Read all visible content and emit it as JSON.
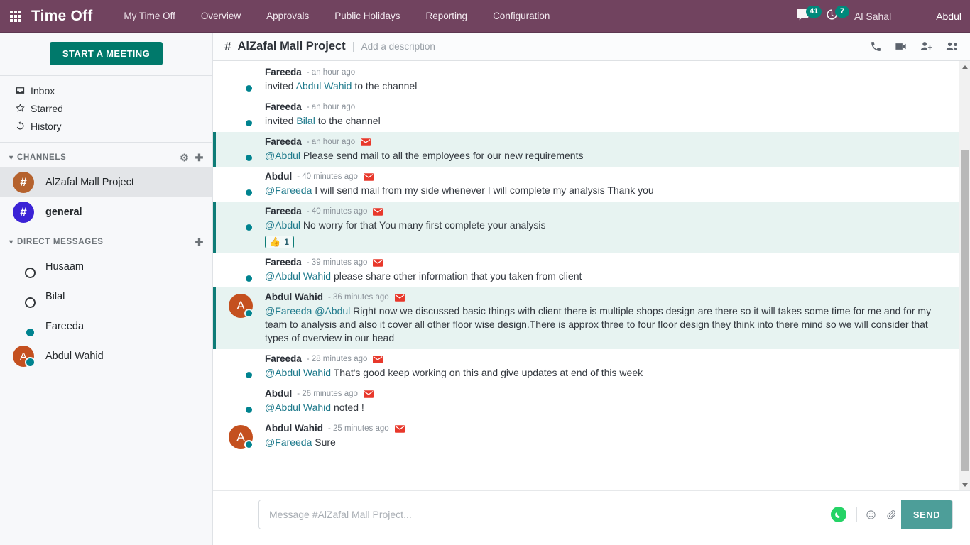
{
  "navbar": {
    "brand": "Time Off",
    "apps_icon": "apps-grid-icon",
    "menu": [
      {
        "label": "My Time Off"
      },
      {
        "label": "Overview"
      },
      {
        "label": "Approvals"
      },
      {
        "label": "Public Holidays"
      },
      {
        "label": "Reporting"
      },
      {
        "label": "Configuration"
      }
    ],
    "messages_icon": "chat-bubble-icon",
    "messages_count": "41",
    "activity_icon": "clock-icon",
    "activity_count": "7",
    "company": "Al Sahal",
    "user": "Abdul",
    "user_avatar": "abdul-avatar",
    "bg_color": "#71435f",
    "badge_color": "#00897b"
  },
  "sidebar": {
    "start_meeting": "START A MEETING",
    "nav": [
      {
        "label": "Inbox",
        "icon": "inbox-icon"
      },
      {
        "label": "Starred",
        "icon": "star-icon"
      },
      {
        "label": "History",
        "icon": "history-icon"
      }
    ],
    "channels": {
      "title": "CHANNELS",
      "settings_icon": "gear-icon",
      "add_icon": "plus-icon",
      "items": [
        {
          "label": "AlZafal Mall Project",
          "hash": "#",
          "color": "#b5622e",
          "active": true,
          "bold": false
        },
        {
          "label": "general",
          "hash": "#",
          "color": "#3b23d6",
          "active": false,
          "bold": true
        }
      ]
    },
    "direct_messages": {
      "title": "DIRECT MESSAGES",
      "add_icon": "plus-icon",
      "items": [
        {
          "label": "Husaam",
          "status": "offline",
          "avatar": "husaam-avatar"
        },
        {
          "label": "Bilal",
          "status": "offline",
          "avatar": "bilal-avatar"
        },
        {
          "label": "Fareeda",
          "status": "online",
          "avatar": "fareeda-avatar"
        },
        {
          "label": "Abdul Wahid",
          "status": "online",
          "avatar": "letter",
          "letter": "A",
          "color": "#c4501f"
        }
      ]
    }
  },
  "channel_header": {
    "hash": "#",
    "title": "AlZafal Mall Project",
    "divider": "|",
    "description_placeholder": "Add a description",
    "icons": [
      {
        "name": "phone-call-icon"
      },
      {
        "name": "video-camera-icon"
      },
      {
        "name": "add-member-icon"
      },
      {
        "name": "members-group-icon"
      }
    ]
  },
  "messages": [
    {
      "author": "Fareeda",
      "time": "- an hour ago",
      "mail_icon": false,
      "highlight": false,
      "avatar": "fareeda-avatar",
      "status": "online",
      "parts": [
        {
          "t": "invited ",
          "m": false
        },
        {
          "t": "Abdul Wahid",
          "m": true
        },
        {
          "t": " to the channel",
          "m": false
        }
      ]
    },
    {
      "author": "Fareeda",
      "time": "- an hour ago",
      "mail_icon": false,
      "highlight": false,
      "avatar": "fareeda-avatar",
      "status": "online",
      "parts": [
        {
          "t": "invited ",
          "m": false
        },
        {
          "t": "Bilal",
          "m": true
        },
        {
          "t": " to the channel",
          "m": false
        }
      ]
    },
    {
      "author": "Fareeda",
      "time": "- an hour ago",
      "mail_icon": true,
      "highlight": true,
      "avatar": "fareeda-avatar",
      "status": "online",
      "parts": [
        {
          "t": "@Abdul",
          "m": true
        },
        {
          "t": " Please send mail to all the employees for our new requirements",
          "m": false
        }
      ]
    },
    {
      "author": "Abdul",
      "time": "- 40 minutes ago",
      "mail_icon": true,
      "highlight": false,
      "avatar": "abdul-avatar",
      "status": "online",
      "parts": [
        {
          "t": "@Fareeda",
          "m": true
        },
        {
          "t": " I will send mail from my side whenever I will complete my analysis Thank you",
          "m": false
        }
      ]
    },
    {
      "author": "Fareeda",
      "time": "- 40 minutes ago",
      "mail_icon": true,
      "highlight": true,
      "avatar": "fareeda-avatar",
      "status": "online",
      "parts": [
        {
          "t": "@Abdul",
          "m": true
        },
        {
          "t": " No worry for that You many first complete your analysis",
          "m": false
        }
      ],
      "reaction": {
        "emoji": "👍",
        "count": "1"
      }
    },
    {
      "author": "Fareeda",
      "time": "- 39 minutes ago",
      "mail_icon": true,
      "highlight": false,
      "avatar": "fareeda-avatar",
      "status": "online",
      "parts": [
        {
          "t": "@Abdul Wahid",
          "m": true
        },
        {
          "t": " please share other information that you taken from client",
          "m": false
        }
      ]
    },
    {
      "author": "Abdul Wahid",
      "time": "- 36 minutes ago",
      "mail_icon": true,
      "highlight": true,
      "avatar": "letter",
      "letter": "A",
      "letter_color": "#c4501f",
      "status": "online",
      "parts": [
        {
          "t": "@Fareeda @Abdul",
          "m": true
        },
        {
          "t": " Right now we discussed basic things with client there is multiple shops design are there so it will takes some time for me and for my team to analysis and also it cover all other floor wise design.There is approx three to four floor design they think into there mind so we will consider that types of overview in our head",
          "m": false
        }
      ]
    },
    {
      "author": "Fareeda",
      "time": "- 28 minutes ago",
      "mail_icon": true,
      "highlight": false,
      "avatar": "fareeda-avatar",
      "status": "online",
      "parts": [
        {
          "t": "@Abdul Wahid",
          "m": true
        },
        {
          "t": " That's good keep working on this and give updates at end of this week",
          "m": false
        }
      ]
    },
    {
      "author": "Abdul",
      "time": "- 26 minutes ago",
      "mail_icon": true,
      "highlight": false,
      "avatar": "abdul-avatar",
      "status": "online",
      "parts": [
        {
          "t": "@Abdul Wahid",
          "m": true
        },
        {
          "t": " noted !",
          "m": false
        }
      ]
    },
    {
      "author": "Abdul Wahid",
      "time": "- 25 minutes ago",
      "mail_icon": true,
      "highlight": false,
      "avatar": "letter",
      "letter": "A",
      "letter_color": "#c4501f",
      "status": "online",
      "parts": [
        {
          "t": "@Fareeda",
          "m": true
        },
        {
          "t": " Sure",
          "m": false
        }
      ]
    }
  ],
  "composer": {
    "avatar": "abdul-avatar",
    "placeholder": "Message #AlZafal Mall Project...",
    "whatsapp_icon": "whatsapp-icon",
    "emoji_icon": "emoji-smiley-icon",
    "attach_icon": "paperclip-icon",
    "send_label": "SEND",
    "send_color": "#4d9e99",
    "whatsapp_color": "#25d366"
  },
  "scrollbar": {
    "up_icon": "scroll-up-arrow-icon",
    "down_icon": "scroll-down-arrow-icon"
  }
}
